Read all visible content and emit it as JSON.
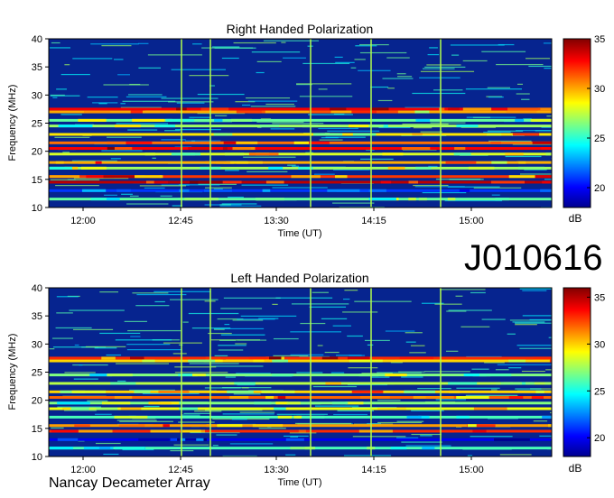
{
  "chart_data": [
    {
      "type": "heatmap",
      "title": "Right Handed Polarization",
      "xlabel": "Time (UT)",
      "ylabel": "Frequency (MHz)",
      "x_ticks": [
        "12:00",
        "12:45",
        "13:30",
        "14:15",
        "15:00"
      ],
      "y_ticks": [
        10,
        15,
        20,
        25,
        30,
        35,
        40
      ],
      "ylim": [
        10,
        40
      ],
      "colorbar": {
        "ticks": [
          20,
          25,
          30,
          35
        ],
        "unit": "dB",
        "range": [
          18,
          35
        ]
      },
      "bands": [
        {
          "freq": 11.5,
          "db": 26
        },
        {
          "freq": 13.0,
          "db": 21
        },
        {
          "freq": 14.5,
          "db": 34
        },
        {
          "freq": 15.5,
          "db": 32
        },
        {
          "freq": 17.0,
          "db": 27
        },
        {
          "freq": 18.0,
          "db": 30
        },
        {
          "freq": 19.5,
          "db": 28
        },
        {
          "freq": 20.5,
          "db": 33
        },
        {
          "freq": 21.5,
          "db": 31
        },
        {
          "freq": 23.0,
          "db": 29
        },
        {
          "freq": 24.5,
          "db": 27
        },
        {
          "freq": 25.5,
          "db": 26
        },
        {
          "freq": 27.0,
          "db": 30
        },
        {
          "freq": 27.5,
          "db": 33
        }
      ]
    },
    {
      "type": "heatmap",
      "title": "Left Handed Polarization",
      "xlabel": "Time (UT)",
      "ylabel": "Frequency (MHz)",
      "x_ticks": [
        "12:00",
        "12:45",
        "13:30",
        "14:15",
        "15:00"
      ],
      "y_ticks": [
        10,
        15,
        20,
        25,
        30,
        35,
        40
      ],
      "ylim": [
        10,
        40
      ],
      "colorbar": {
        "ticks": [
          20,
          25,
          30,
          35
        ],
        "unit": "dB",
        "range": [
          18,
          36
        ]
      },
      "bands": [
        {
          "freq": 11.5,
          "db": 26
        },
        {
          "freq": 13.0,
          "db": 20
        },
        {
          "freq": 14.5,
          "db": 33
        },
        {
          "freq": 15.5,
          "db": 31
        },
        {
          "freq": 17.0,
          "db": 26
        },
        {
          "freq": 18.5,
          "db": 29
        },
        {
          "freq": 19.5,
          "db": 27
        },
        {
          "freq": 20.5,
          "db": 32
        },
        {
          "freq": 21.5,
          "db": 30
        },
        {
          "freq": 23.0,
          "db": 28
        },
        {
          "freq": 24.5,
          "db": 27
        },
        {
          "freq": 27.0,
          "db": 30
        },
        {
          "freq": 27.5,
          "db": 33
        }
      ]
    }
  ],
  "source_id": "J010616",
  "credit": "Nancay Decameter Array"
}
